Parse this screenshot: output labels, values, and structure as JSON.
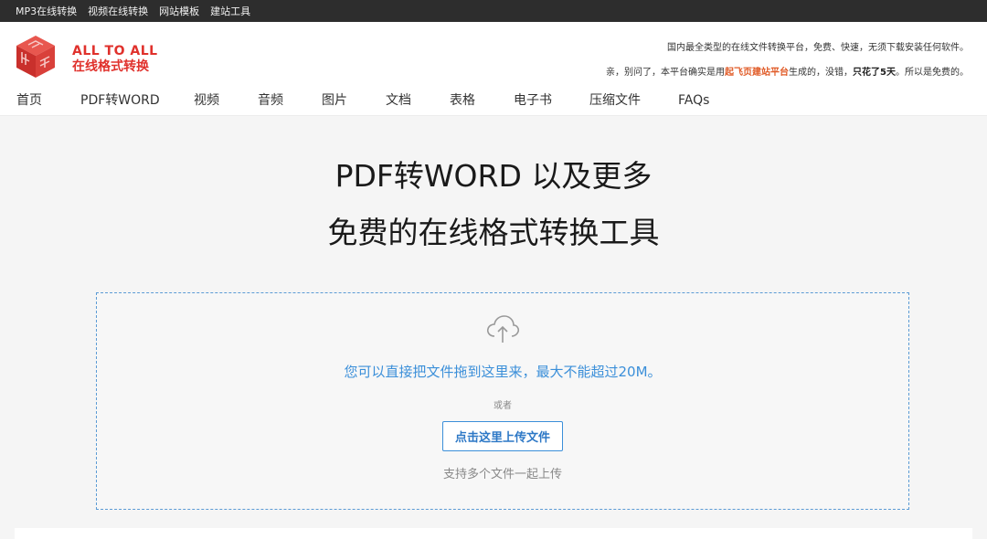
{
  "topbar": {
    "links": [
      "MP3在线转换",
      "视频在线转换",
      "网站模板",
      "建站工具"
    ]
  },
  "header": {
    "logo_line1": "ALL TO ALL",
    "logo_line2": "在线格式转换",
    "tagline": "国内最全类型的在线文件转换平台，免费、快速，无须下载安装任何软件。",
    "notice_prefix": "亲，别问了，本平台确实是用",
    "notice_highlight": "起飞页建站平台",
    "notice_middle": "生成的，没错，",
    "notice_strong": "只花了5天",
    "notice_suffix": "。所以是免费的。"
  },
  "nav": {
    "items": [
      "首页",
      "PDF转WORD",
      "视频",
      "音频",
      "图片",
      "文档",
      "表格",
      "电子书",
      "压缩文件",
      "FAQs"
    ]
  },
  "hero": {
    "line1": "PDF转WORD 以及更多",
    "line2": "免费的在线格式转换工具"
  },
  "dropzone": {
    "icon": "cloud-upload-icon",
    "drop_text": "您可以直接把文件拖到这里来，最大不能超过20M。",
    "or_text": "或者",
    "upload_label": "点击这里上传文件",
    "multi_text": "支持多个文件一起上传"
  },
  "colors": {
    "accent": "#e0312c",
    "link_blue": "#3b8fd9",
    "topbar_bg": "#2d2d2d"
  }
}
